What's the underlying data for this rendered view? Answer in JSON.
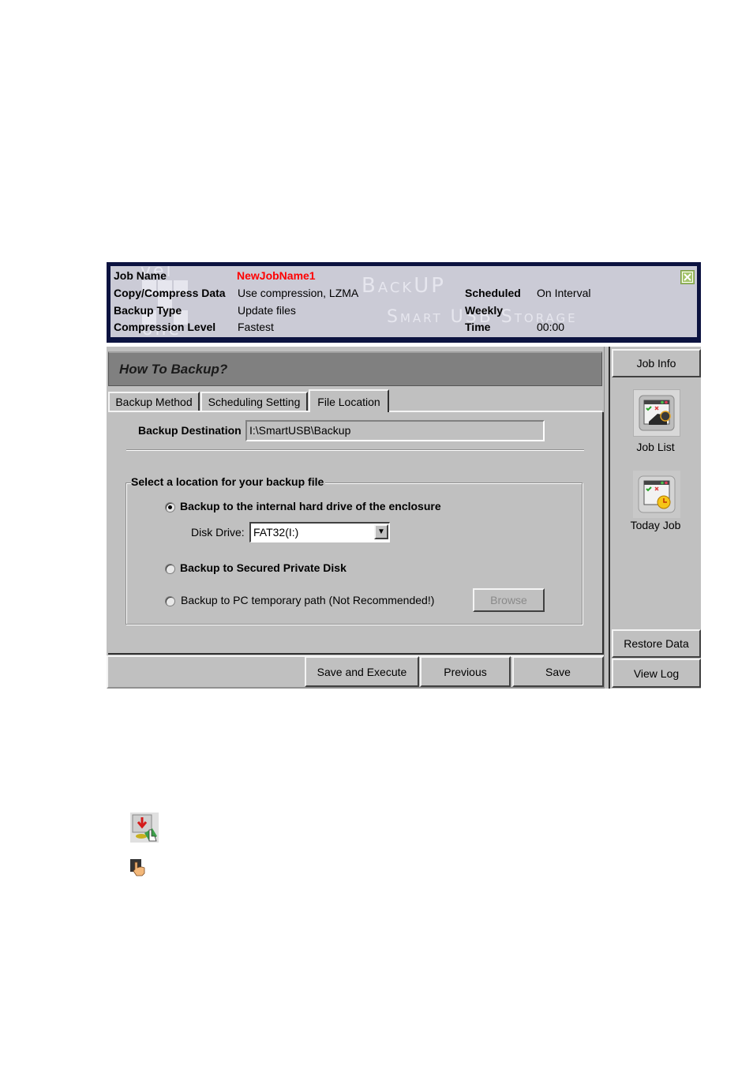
{
  "header": {
    "watermark": {
      "brand_top": "vel",
      "brand_bottom": "one",
      "line1": "BackUP",
      "line2": "Smart USB Storage"
    },
    "rows_left": [
      {
        "label": "Job Name",
        "value": "NewJobName1"
      },
      {
        "label": "Copy/Compress Data",
        "value": "Use compression, LZMA"
      },
      {
        "label": "Backup Type",
        "value": "Update files"
      },
      {
        "label": "Compression Level",
        "value": "Fastest"
      }
    ],
    "rows_right": [
      {
        "label": "Scheduled",
        "value": "On Interval"
      },
      {
        "label": "Weekly",
        "value": ""
      },
      {
        "label": "Time",
        "value": "00:00"
      }
    ],
    "job_name_color": "#ff0000",
    "close_icon": "close-x-icon"
  },
  "main": {
    "title": "How To Backup?",
    "tabs": [
      {
        "label": "Backup Method",
        "active": false
      },
      {
        "label": "Scheduling Setting",
        "active": false
      },
      {
        "label": "File Location",
        "active": true
      }
    ],
    "destination": {
      "label": "Backup Destination",
      "value": "I:\\SmartUSB\\Backup"
    },
    "location_group": {
      "legend": "Select a location for your backup file",
      "options": [
        {
          "label": "Backup to the internal hard drive of the enclosure",
          "selected": true
        },
        {
          "label": "Backup to Secured Private Disk",
          "selected": false
        },
        {
          "label": "Backup to PC temporary path (Not Recommended!)",
          "selected": false
        }
      ],
      "disk_drive": {
        "label": "Disk Drive:",
        "value": "FAT32(I:)"
      },
      "browse_label": "Browse"
    },
    "footer_buttons": {
      "save_execute": "Save and Execute",
      "previous": "Previous",
      "save": "Save"
    }
  },
  "sidebar": {
    "job_info": "Job Info",
    "items": [
      {
        "label": "Job List",
        "icon": "job-list-icon"
      },
      {
        "label": "Today Job",
        "icon": "today-job-icon"
      }
    ],
    "restore_data": "Restore Data",
    "view_log": "View Log"
  },
  "page_icons": [
    {
      "icon": "restore-data-icon"
    },
    {
      "icon": "pointer-hand-icon"
    }
  ]
}
